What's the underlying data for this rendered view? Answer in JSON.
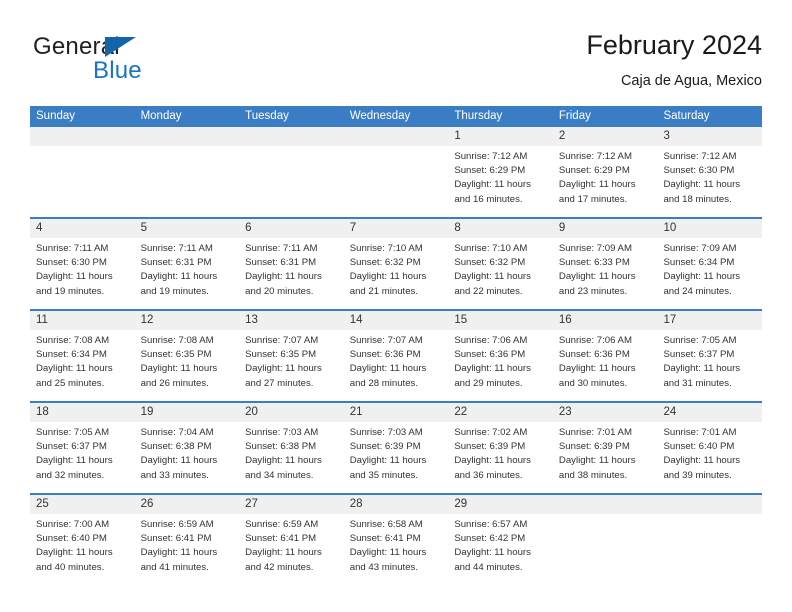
{
  "brand": {
    "name_top": "General",
    "name_bottom": "Blue",
    "accent_color": "#1a74c4"
  },
  "header": {
    "title": "February 2024",
    "subtitle": "Caja de Agua, Mexico"
  },
  "calendar": {
    "header_bg": "#3b7dc4",
    "num_row_bg": "#f0f0f0",
    "day_names": [
      "Sunday",
      "Monday",
      "Tuesday",
      "Wednesday",
      "Thursday",
      "Friday",
      "Saturday"
    ],
    "weeks": [
      [
        {
          "day": "",
          "sunrise": "",
          "sunset": "",
          "daylight": ""
        },
        {
          "day": "",
          "sunrise": "",
          "sunset": "",
          "daylight": ""
        },
        {
          "day": "",
          "sunrise": "",
          "sunset": "",
          "daylight": ""
        },
        {
          "day": "",
          "sunrise": "",
          "sunset": "",
          "daylight": ""
        },
        {
          "day": "1",
          "sunrise": "Sunrise: 7:12 AM",
          "sunset": "Sunset: 6:29 PM",
          "daylight": "Daylight: 11 hours and 16 minutes."
        },
        {
          "day": "2",
          "sunrise": "Sunrise: 7:12 AM",
          "sunset": "Sunset: 6:29 PM",
          "daylight": "Daylight: 11 hours and 17 minutes."
        },
        {
          "day": "3",
          "sunrise": "Sunrise: 7:12 AM",
          "sunset": "Sunset: 6:30 PM",
          "daylight": "Daylight: 11 hours and 18 minutes."
        }
      ],
      [
        {
          "day": "4",
          "sunrise": "Sunrise: 7:11 AM",
          "sunset": "Sunset: 6:30 PM",
          "daylight": "Daylight: 11 hours and 19 minutes."
        },
        {
          "day": "5",
          "sunrise": "Sunrise: 7:11 AM",
          "sunset": "Sunset: 6:31 PM",
          "daylight": "Daylight: 11 hours and 19 minutes."
        },
        {
          "day": "6",
          "sunrise": "Sunrise: 7:11 AM",
          "sunset": "Sunset: 6:31 PM",
          "daylight": "Daylight: 11 hours and 20 minutes."
        },
        {
          "day": "7",
          "sunrise": "Sunrise: 7:10 AM",
          "sunset": "Sunset: 6:32 PM",
          "daylight": "Daylight: 11 hours and 21 minutes."
        },
        {
          "day": "8",
          "sunrise": "Sunrise: 7:10 AM",
          "sunset": "Sunset: 6:32 PM",
          "daylight": "Daylight: 11 hours and 22 minutes."
        },
        {
          "day": "9",
          "sunrise": "Sunrise: 7:09 AM",
          "sunset": "Sunset: 6:33 PM",
          "daylight": "Daylight: 11 hours and 23 minutes."
        },
        {
          "day": "10",
          "sunrise": "Sunrise: 7:09 AM",
          "sunset": "Sunset: 6:34 PM",
          "daylight": "Daylight: 11 hours and 24 minutes."
        }
      ],
      [
        {
          "day": "11",
          "sunrise": "Sunrise: 7:08 AM",
          "sunset": "Sunset: 6:34 PM",
          "daylight": "Daylight: 11 hours and 25 minutes."
        },
        {
          "day": "12",
          "sunrise": "Sunrise: 7:08 AM",
          "sunset": "Sunset: 6:35 PM",
          "daylight": "Daylight: 11 hours and 26 minutes."
        },
        {
          "day": "13",
          "sunrise": "Sunrise: 7:07 AM",
          "sunset": "Sunset: 6:35 PM",
          "daylight": "Daylight: 11 hours and 27 minutes."
        },
        {
          "day": "14",
          "sunrise": "Sunrise: 7:07 AM",
          "sunset": "Sunset: 6:36 PM",
          "daylight": "Daylight: 11 hours and 28 minutes."
        },
        {
          "day": "15",
          "sunrise": "Sunrise: 7:06 AM",
          "sunset": "Sunset: 6:36 PM",
          "daylight": "Daylight: 11 hours and 29 minutes."
        },
        {
          "day": "16",
          "sunrise": "Sunrise: 7:06 AM",
          "sunset": "Sunset: 6:36 PM",
          "daylight": "Daylight: 11 hours and 30 minutes."
        },
        {
          "day": "17",
          "sunrise": "Sunrise: 7:05 AM",
          "sunset": "Sunset: 6:37 PM",
          "daylight": "Daylight: 11 hours and 31 minutes."
        }
      ],
      [
        {
          "day": "18",
          "sunrise": "Sunrise: 7:05 AM",
          "sunset": "Sunset: 6:37 PM",
          "daylight": "Daylight: 11 hours and 32 minutes."
        },
        {
          "day": "19",
          "sunrise": "Sunrise: 7:04 AM",
          "sunset": "Sunset: 6:38 PM",
          "daylight": "Daylight: 11 hours and 33 minutes."
        },
        {
          "day": "20",
          "sunrise": "Sunrise: 7:03 AM",
          "sunset": "Sunset: 6:38 PM",
          "daylight": "Daylight: 11 hours and 34 minutes."
        },
        {
          "day": "21",
          "sunrise": "Sunrise: 7:03 AM",
          "sunset": "Sunset: 6:39 PM",
          "daylight": "Daylight: 11 hours and 35 minutes."
        },
        {
          "day": "22",
          "sunrise": "Sunrise: 7:02 AM",
          "sunset": "Sunset: 6:39 PM",
          "daylight": "Daylight: 11 hours and 36 minutes."
        },
        {
          "day": "23",
          "sunrise": "Sunrise: 7:01 AM",
          "sunset": "Sunset: 6:39 PM",
          "daylight": "Daylight: 11 hours and 38 minutes."
        },
        {
          "day": "24",
          "sunrise": "Sunrise: 7:01 AM",
          "sunset": "Sunset: 6:40 PM",
          "daylight": "Daylight: 11 hours and 39 minutes."
        }
      ],
      [
        {
          "day": "25",
          "sunrise": "Sunrise: 7:00 AM",
          "sunset": "Sunset: 6:40 PM",
          "daylight": "Daylight: 11 hours and 40 minutes."
        },
        {
          "day": "26",
          "sunrise": "Sunrise: 6:59 AM",
          "sunset": "Sunset: 6:41 PM",
          "daylight": "Daylight: 11 hours and 41 minutes."
        },
        {
          "day": "27",
          "sunrise": "Sunrise: 6:59 AM",
          "sunset": "Sunset: 6:41 PM",
          "daylight": "Daylight: 11 hours and 42 minutes."
        },
        {
          "day": "28",
          "sunrise": "Sunrise: 6:58 AM",
          "sunset": "Sunset: 6:41 PM",
          "daylight": "Daylight: 11 hours and 43 minutes."
        },
        {
          "day": "29",
          "sunrise": "Sunrise: 6:57 AM",
          "sunset": "Sunset: 6:42 PM",
          "daylight": "Daylight: 11 hours and 44 minutes."
        },
        {
          "day": "",
          "sunrise": "",
          "sunset": "",
          "daylight": ""
        },
        {
          "day": "",
          "sunrise": "",
          "sunset": "",
          "daylight": ""
        }
      ]
    ]
  }
}
